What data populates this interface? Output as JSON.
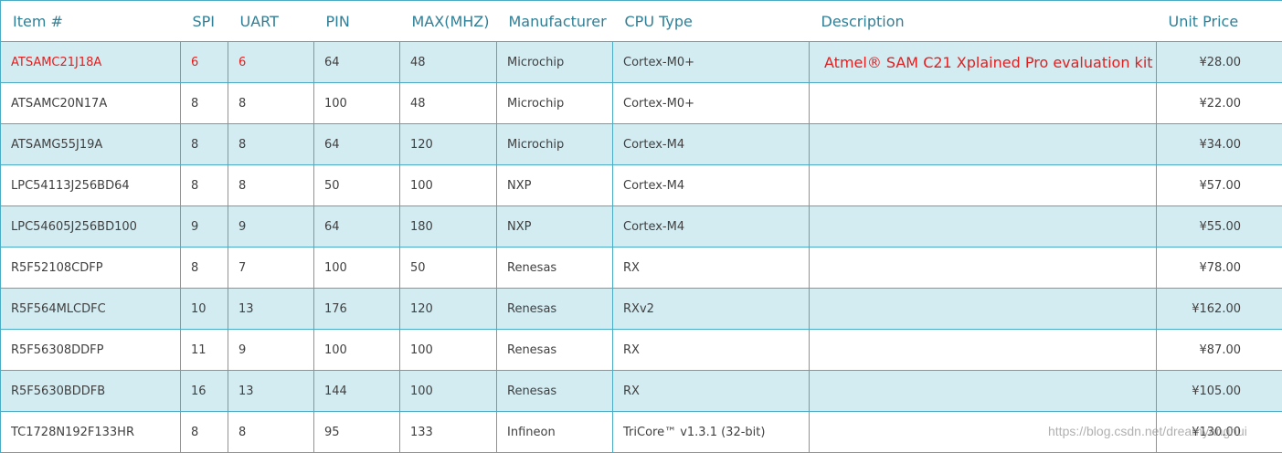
{
  "table": {
    "headers": [
      "Item #",
      "SPI",
      "UART",
      "PIN",
      "MAX(MHZ)",
      "Manufacturer",
      "CPU Type",
      "Description",
      "Unit Price"
    ],
    "rows": [
      {
        "item": "ATSAMC21J18A",
        "spi": "6",
        "uart": "6",
        "pin": "64",
        "max_mhz": "48",
        "manufacturer": "Microchip",
        "cpu_type": "Cortex-M0+",
        "description": "Atmel® SAM C21 Xplained Pro evaluation kit",
        "unit_price": "¥28.00"
      },
      {
        "item": "ATSAMC20N17A",
        "spi": "8",
        "uart": "8",
        "pin": "100",
        "max_mhz": "48",
        "manufacturer": "Microchip",
        "cpu_type": "Cortex-M0+",
        "description": "",
        "unit_price": "¥22.00"
      },
      {
        "item": "ATSAMG55J19A",
        "spi": "8",
        "uart": "8",
        "pin": "64",
        "max_mhz": "120",
        "manufacturer": "Microchip",
        "cpu_type": "Cortex-M4",
        "description": "",
        "unit_price": "¥34.00"
      },
      {
        "item": "LPC54113J256BD64",
        "spi": "8",
        "uart": "8",
        "pin": "50",
        "max_mhz": "100",
        "manufacturer": "NXP",
        "cpu_type": "Cortex-M4",
        "description": "",
        "unit_price": "¥57.00"
      },
      {
        "item": "LPC54605J256BD100",
        "spi": "9",
        "uart": "9",
        "pin": "64",
        "max_mhz": "180",
        "manufacturer": "NXP",
        "cpu_type": "Cortex-M4",
        "description": "",
        "unit_price": "¥55.00"
      },
      {
        "item": "R5F52108CDFP",
        "spi": "8",
        "uart": "7",
        "pin": "100",
        "max_mhz": "50",
        "manufacturer": "Renesas",
        "cpu_type": "RX",
        "description": "",
        "unit_price": "¥78.00"
      },
      {
        "item": "R5F564MLCDFC",
        "spi": "10",
        "uart": "13",
        "pin": "176",
        "max_mhz": "120",
        "manufacturer": "Renesas",
        "cpu_type": "RXv2",
        "description": "",
        "unit_price": "¥162.00"
      },
      {
        "item": "R5F56308DDFP",
        "spi": "11",
        "uart": "9",
        "pin": "100",
        "max_mhz": "100",
        "manufacturer": "Renesas",
        "cpu_type": "RX",
        "description": "",
        "unit_price": "¥87.00"
      },
      {
        "item": "R5F5630BDDFB",
        "spi": "16",
        "uart": "13",
        "pin": "144",
        "max_mhz": "100",
        "manufacturer": "Renesas",
        "cpu_type": "RX",
        "description": "",
        "unit_price": "¥105.00"
      },
      {
        "item": "TC1728N192F133HR",
        "spi": "8",
        "uart": "8",
        "pin": "95",
        "max_mhz": "133",
        "manufacturer": "Infineon",
        "cpu_type": "TriCore™ v1.3.1 (32-bit)",
        "description": "",
        "unit_price": "¥130.00"
      }
    ]
  },
  "watermark": "https://blog.csdn.net/dreamyanghui",
  "colors": {
    "header_text": "#2f7f96",
    "border": "#4bacc6",
    "band_fill": "#d3ecf2",
    "body_text": "#404040",
    "highlight_text": "#e31e1e"
  }
}
